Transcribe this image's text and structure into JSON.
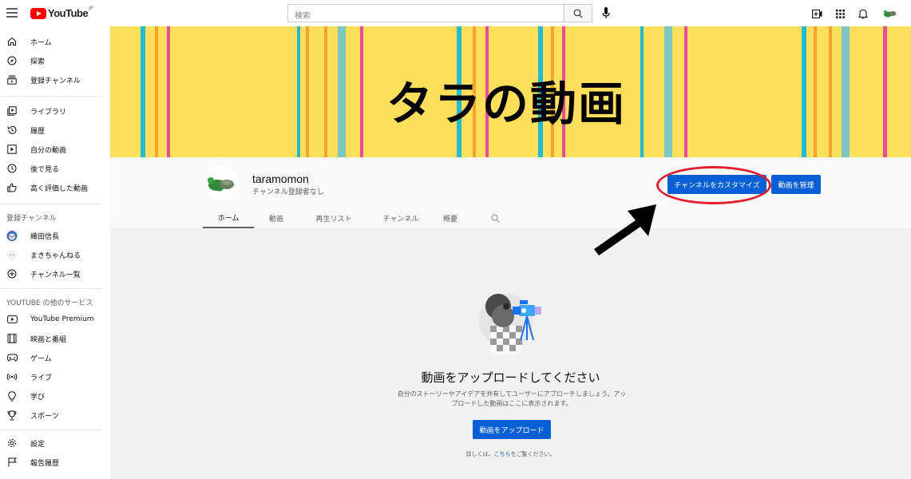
{
  "header": {
    "logo_text": "YouTube",
    "logo_region": "JP",
    "search_placeholder": "検索"
  },
  "sidebar": {
    "main": [
      {
        "label": "ホーム",
        "icon": "home-icon"
      },
      {
        "label": "探索",
        "icon": "compass-icon"
      },
      {
        "label": "登録チャンネル",
        "icon": "subscriptions-icon"
      }
    ],
    "library": [
      {
        "label": "ライブラリ",
        "icon": "library-icon"
      },
      {
        "label": "履歴",
        "icon": "history-icon"
      },
      {
        "label": "自分の動画",
        "icon": "my-videos-icon"
      },
      {
        "label": "後で見る",
        "icon": "watch-later-icon"
      },
      {
        "label": "高く評価した動画",
        "icon": "thumbs-up-icon"
      }
    ],
    "subscriptions_heading": "登録チャンネル",
    "subscriptions": [
      {
        "label": "織田信長"
      },
      {
        "label": "まきちゃんねる"
      },
      {
        "label": "チャンネル一覧"
      }
    ],
    "more_heading": "YOUTUBE の他のサービス",
    "more": [
      {
        "label": "YouTube Premium"
      },
      {
        "label": "映画と番組"
      },
      {
        "label": "ゲーム"
      },
      {
        "label": "ライブ"
      },
      {
        "label": "学び"
      },
      {
        "label": "スポーツ"
      }
    ],
    "settings": [
      {
        "label": "設定"
      },
      {
        "label": "報告履歴"
      }
    ]
  },
  "banner": {
    "text": "タラの動画",
    "bg_color": "#fedf5b"
  },
  "channel": {
    "name": "taramomon",
    "subscribers": "チャンネル登録者なし",
    "customize_button": "チャンネルをカスタマイズ",
    "manage_button": "動画を管理",
    "tabs": [
      "ホーム",
      "動画",
      "再生リスト",
      "チャンネル",
      "概要"
    ]
  },
  "empty_state": {
    "title": "動画をアップロードしてください",
    "description": "自分のストーリーやアイデアを共有してユーザーにアプローチしましょう。アップロードした動画はここに表示されます。",
    "upload_button": "動画をアップロード",
    "help_prefix": "詳しくは、",
    "help_link": "こちら",
    "help_suffix": "をご覧ください。"
  },
  "colors": {
    "accent": "#065fd4",
    "annotation_red": "#e0202e"
  }
}
